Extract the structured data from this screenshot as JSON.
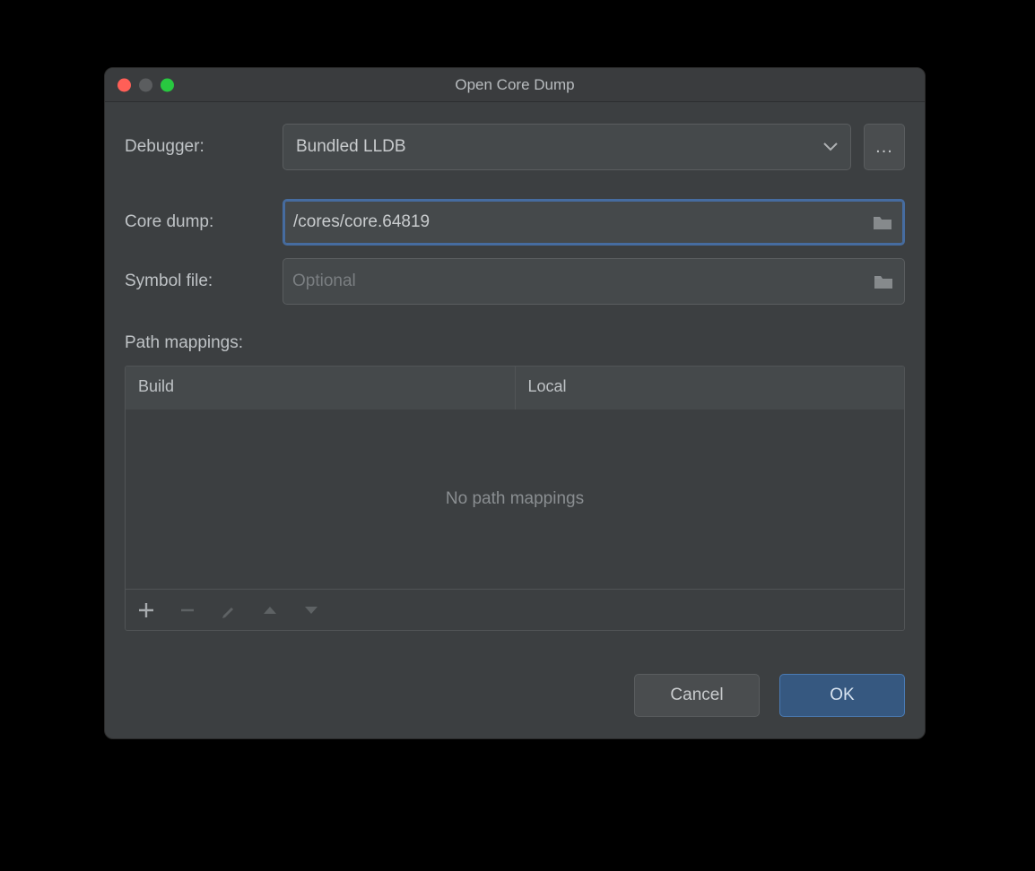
{
  "dialog": {
    "title": "Open Core Dump",
    "debugger_label": "Debugger:",
    "debugger_value": "Bundled LLDB",
    "debugger_more": "...",
    "core_dump_label": "Core dump:",
    "core_dump_value": "/cores/core.64819",
    "symbol_file_label": "Symbol file:",
    "symbol_file_value": "",
    "symbol_file_placeholder": "Optional",
    "path_mappings_label": "Path mappings:",
    "table": {
      "headers": [
        "Build",
        "Local"
      ],
      "empty_text": "No path mappings"
    },
    "buttons": {
      "cancel": "Cancel",
      "ok": "OK"
    }
  }
}
